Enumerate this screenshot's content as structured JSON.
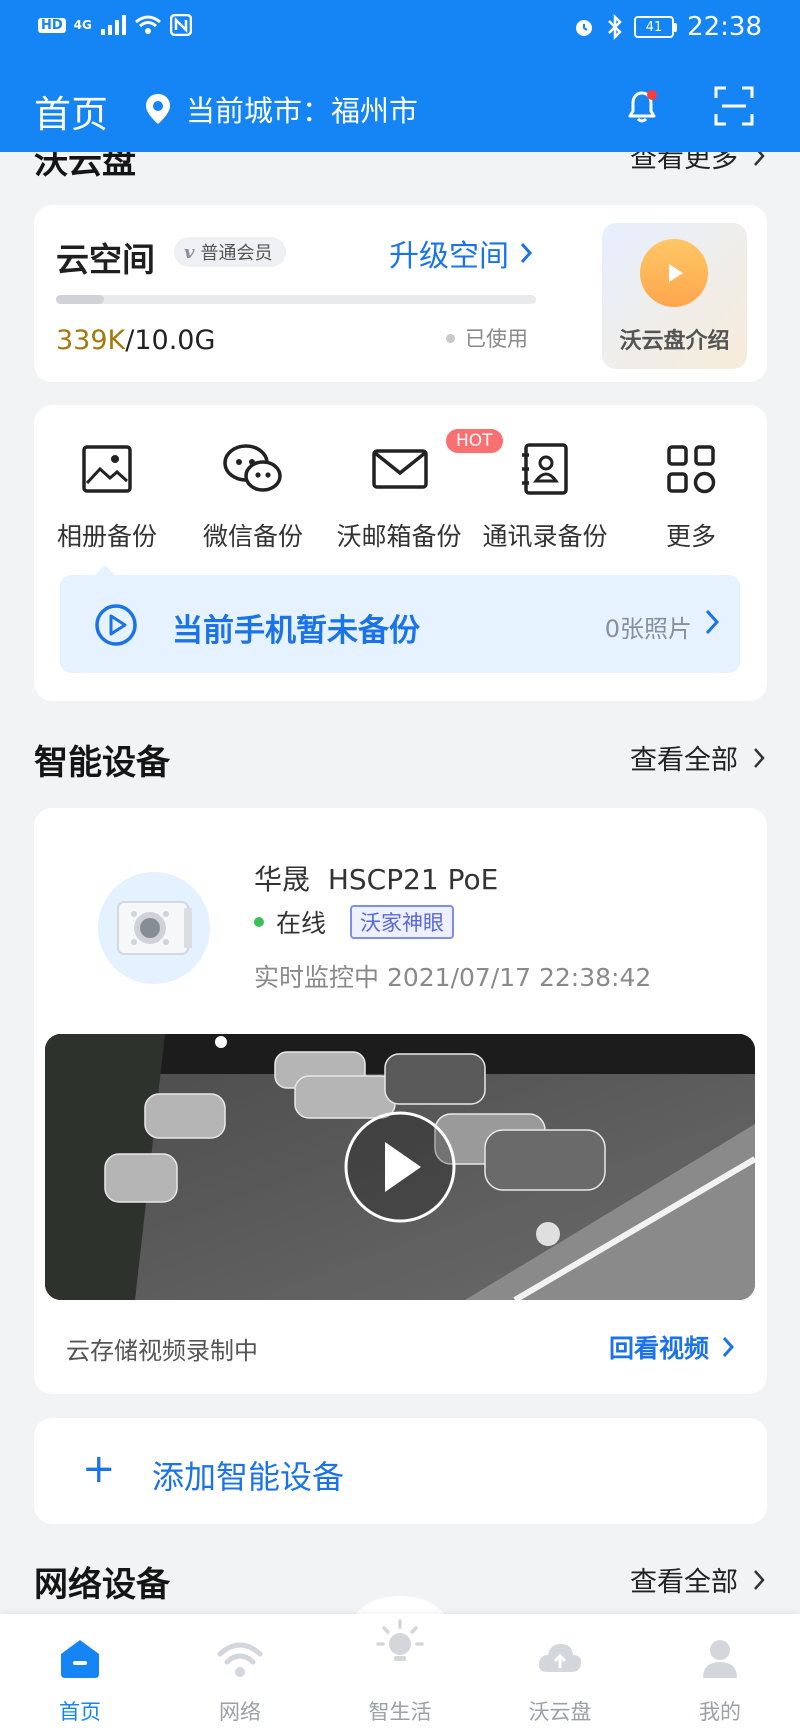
{
  "status_bar": {
    "left_icons": [
      "HD",
      "4G",
      "signal-icon",
      "wifi-icon",
      "nfc-icon"
    ],
    "hd": "HD",
    "net": "4G",
    "battery": "41",
    "time": "22:38"
  },
  "header": {
    "title": "首页",
    "city_label": "当前城市：",
    "city": "福州市"
  },
  "cloud_section": {
    "title": "沃云盘",
    "more": "查看更多"
  },
  "cloud_card": {
    "title": "云空间",
    "member_badge": "普通会员",
    "badge_letter": "v",
    "upgrade": "升级空间",
    "used_num": "339K",
    "total": "/10.0G",
    "used_label": "已使用",
    "usage_fraction": 0.1,
    "intro_label": "沃云盘介绍"
  },
  "backup": {
    "items": [
      {
        "label": "相册备份",
        "icon": "album-icon"
      },
      {
        "label": "微信备份",
        "icon": "wechat-icon"
      },
      {
        "label": "沃邮箱备份",
        "icon": "mail-icon"
      },
      {
        "label": "通讯录备份",
        "icon": "contacts-icon"
      },
      {
        "label": "更多",
        "icon": "grid-icon"
      }
    ],
    "hot": "HOT",
    "notice": "当前手机暂未备份",
    "photo_count": "0张照片"
  },
  "smart_section": {
    "title": "智能设备",
    "more": "查看全部"
  },
  "device": {
    "brand": "华晟",
    "model": "HSCP21 PoE",
    "status": "在线",
    "tag": "沃家神眼",
    "monitor_text": "实时监控中 2021/07/17 22:38:42",
    "recording": "云存储视频录制中",
    "replay": "回看视频"
  },
  "add_device": {
    "plus": "+",
    "label": "添加智能设备"
  },
  "network_section": {
    "title": "网络设备",
    "more": "查看全部"
  },
  "nav": {
    "items": [
      {
        "label": "首页",
        "icon": "home-icon",
        "active": true
      },
      {
        "label": "网络",
        "icon": "wifi-icon",
        "active": false
      },
      {
        "label": "智生活",
        "icon": "bulb-icon",
        "active": false
      },
      {
        "label": "沃云盘",
        "icon": "cloud-upload-icon",
        "active": false
      },
      {
        "label": "我的",
        "icon": "user-icon",
        "active": false
      }
    ]
  },
  "colors": {
    "primary": "#1584f5",
    "link": "#1a73e8",
    "gold": "#a37a0b",
    "hot": "#fa6f6f",
    "online": "#3dbf5a"
  }
}
